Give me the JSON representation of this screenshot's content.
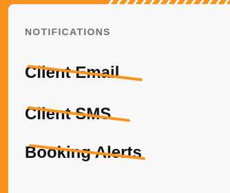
{
  "panel": {
    "title": "NOTIFICATIONS"
  },
  "items": [
    {
      "label": "Client Email",
      "disabled": true
    },
    {
      "label": "Client SMS",
      "disabled": true
    },
    {
      "label": "Booking Alerts",
      "disabled": true
    }
  ],
  "colors": {
    "accent": "#f7931e",
    "panel_background": "#f7f7f7",
    "title_text": "#6e6e6e",
    "item_text": "#111111"
  }
}
